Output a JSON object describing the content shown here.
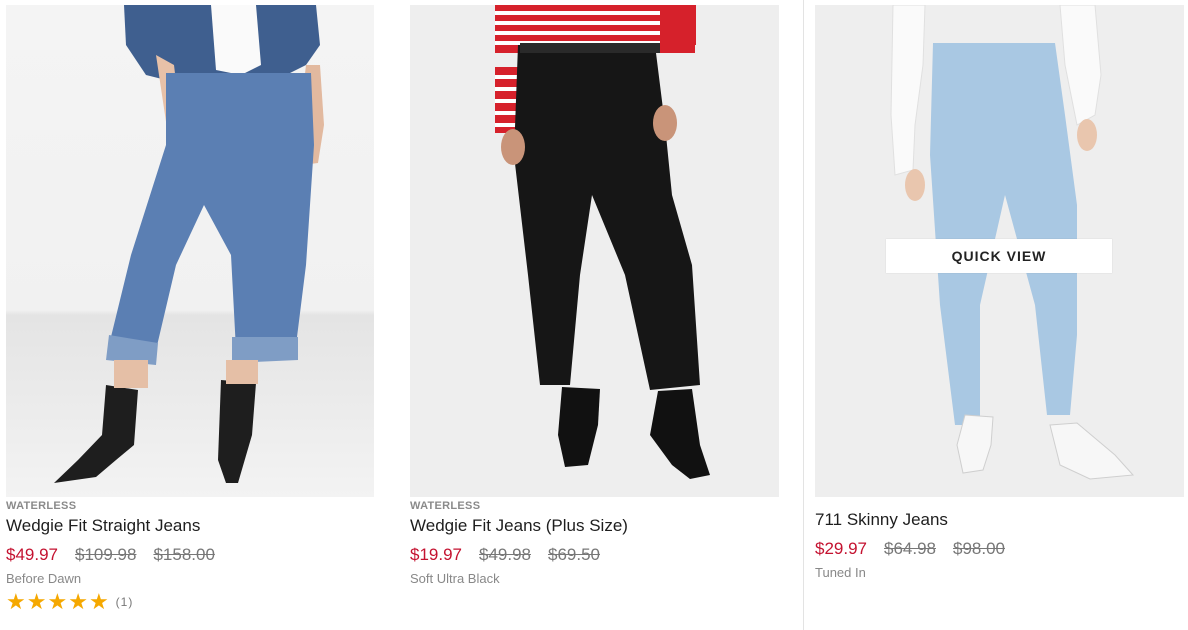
{
  "products": [
    {
      "tag": "WATERLESS",
      "name": "Wedgie Fit Straight Jeans",
      "sale_price": "$49.97",
      "was_price_1": "$109.98",
      "was_price_2": "$158.00",
      "color": "Before Dawn",
      "rating_stars": 5,
      "review_count": "(1)"
    },
    {
      "tag": "WATERLESS",
      "name": "Wedgie Fit Jeans (Plus Size)",
      "sale_price": "$19.97",
      "was_price_1": "$49.98",
      "was_price_2": "$69.50",
      "color": "Soft Ultra Black"
    },
    {
      "name": "711 Skinny Jeans",
      "sale_price": "$29.97",
      "was_price_1": "$64.98",
      "was_price_2": "$98.00",
      "color": "Tuned In",
      "quick_view_label": "QUICK VIEW"
    }
  ],
  "colors": {
    "sale_price": "#c41230",
    "strike_price": "#777777",
    "star": "#f5a800"
  }
}
